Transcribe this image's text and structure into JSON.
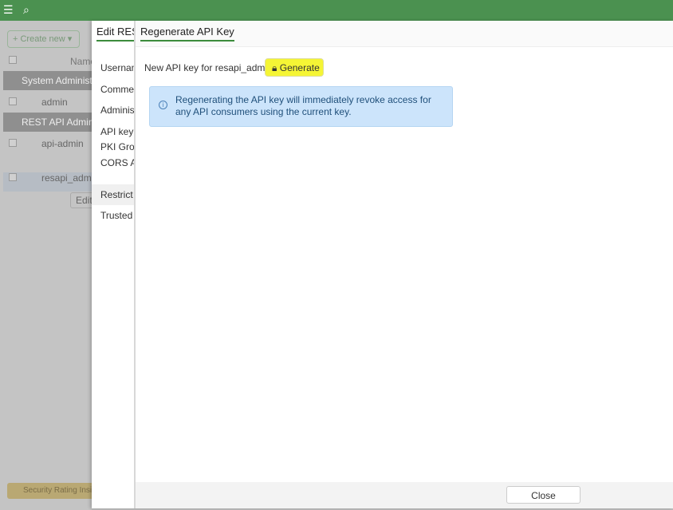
{
  "topbar": {
    "menu_icon": "☰",
    "search_icon": "⌕"
  },
  "background": {
    "create_new": "+ Create new ▾",
    "name_header": "Name",
    "groups": [
      "System Administrator",
      "REST API Administrator"
    ],
    "users": [
      "admin",
      "api-admin",
      "resapi_admin"
    ],
    "edit_label": "Edit",
    "security_rating": "Security Rating Insights"
  },
  "edit_panel": {
    "title": "Edit REST API Admin",
    "labels": [
      "Username",
      "Comments",
      "Administrator profile",
      "API key",
      "PKI Group",
      "CORS Allow Origin",
      "Restrict login to trusted hosts",
      "Trusted Hosts"
    ]
  },
  "regen_panel": {
    "title": "Regenerate API Key",
    "new_key_label": "New API key for resapi_admin",
    "generate_label": "Generate",
    "info_text": "Regenerating the API key will immediately revoke access for any API consumers using the current key.",
    "close_label": "Close",
    "highlight_color": "#f5f535"
  }
}
